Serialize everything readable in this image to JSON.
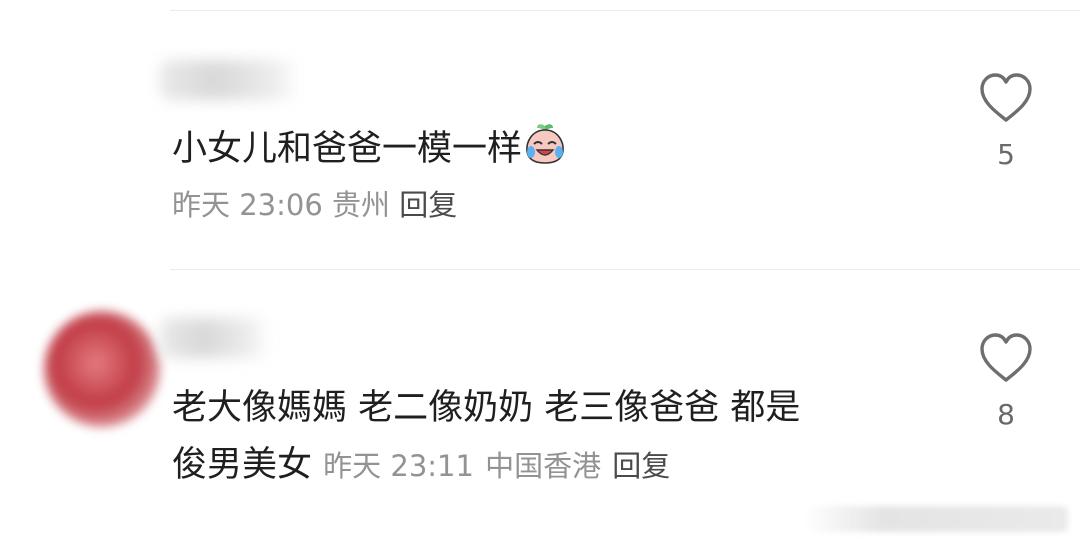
{
  "comments": [
    {
      "text": "小女儿和爸爸一模一样",
      "emoji": "crying-laughing-peach-emoji",
      "time": "昨天 23:06",
      "location": "贵州",
      "reply_label": "回复",
      "likes": "5"
    },
    {
      "text_line1": "老大像媽媽 老二像奶奶 老三像爸爸 都是",
      "text_line2": "俊男美女",
      "time": "昨天 23:11",
      "location": "中国香港",
      "reply_label": "回复",
      "likes": "8"
    }
  ],
  "colors": {
    "text": "#1f1f1f",
    "meta": "#939393",
    "divider": "#ececec",
    "heart_outline": "#6e6e6e"
  },
  "icons": [
    "heart-outline-icon",
    "heart-outline-icon"
  ]
}
